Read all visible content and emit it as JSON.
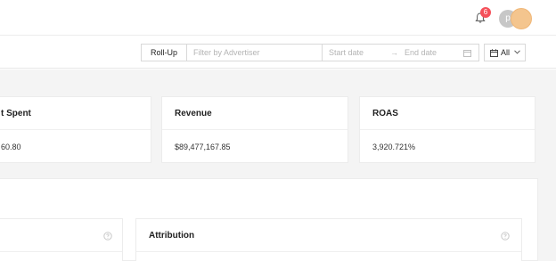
{
  "header": {
    "notifications": {
      "count": "6",
      "icon": "bell-icon"
    },
    "avatar_letter": "p"
  },
  "filters": {
    "rollup_label": "Roll-Up",
    "advertiser_placeholder": "Filter by Advertiser",
    "start_placeholder": "Start date",
    "arrow": "→",
    "end_placeholder": "End date",
    "scope_value": "All"
  },
  "metrics": [
    {
      "title": "t Spent",
      "value": "60.80"
    },
    {
      "title": "Revenue",
      "value": "$89,477,167.85"
    },
    {
      "title": "ROAS",
      "value": "3,920.721%"
    }
  ],
  "sections": {
    "attribution_title": "Attribution"
  }
}
